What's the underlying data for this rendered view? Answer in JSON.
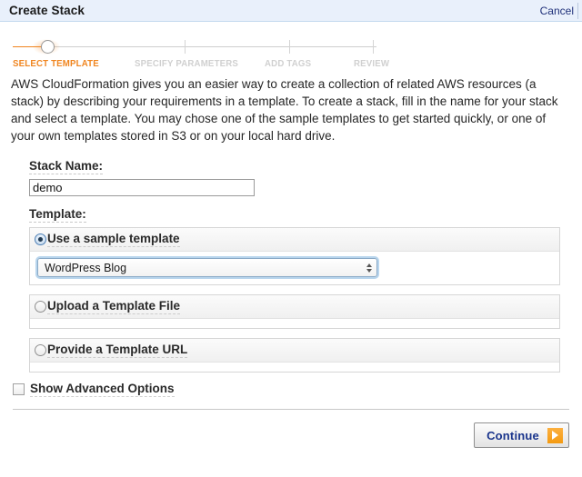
{
  "titlebar": {
    "title": "Create Stack",
    "cancel_label": "Cancel"
  },
  "steps": [
    {
      "label": "SELECT TEMPLATE",
      "state": "active"
    },
    {
      "label": "SPECIFY PARAMETERS",
      "state": "inactive"
    },
    {
      "label": "ADD TAGS",
      "state": "inactive"
    },
    {
      "label": "REVIEW",
      "state": "inactive"
    }
  ],
  "description": "AWS CloudFormation gives you an easier way to create a collection of related AWS resources (a stack) by describing your requirements in a template. To create a stack, fill in the name for your stack and select a template. You may chose one of the sample templates to get started quickly, or one of your own templates stored in S3 or on your local hard drive.",
  "form": {
    "stack_name_label": "Stack Name:",
    "stack_name_value": "demo",
    "stack_name_placeholder": "",
    "template_label": "Template:",
    "options": [
      {
        "label": "Use a sample template",
        "selected": true
      },
      {
        "label": "Upload a Template File",
        "selected": false
      },
      {
        "label": "Provide a Template URL",
        "selected": false
      }
    ],
    "sample_template_selected": "WordPress Blog",
    "advanced_label": "Show Advanced Options",
    "advanced_checked": false
  },
  "footer": {
    "continue_label": "Continue"
  },
  "colors": {
    "accent_orange": "#f0851f",
    "titlebar_bg": "#e9f0fb",
    "link_navy": "#20317a",
    "button_text": "#19348c"
  }
}
